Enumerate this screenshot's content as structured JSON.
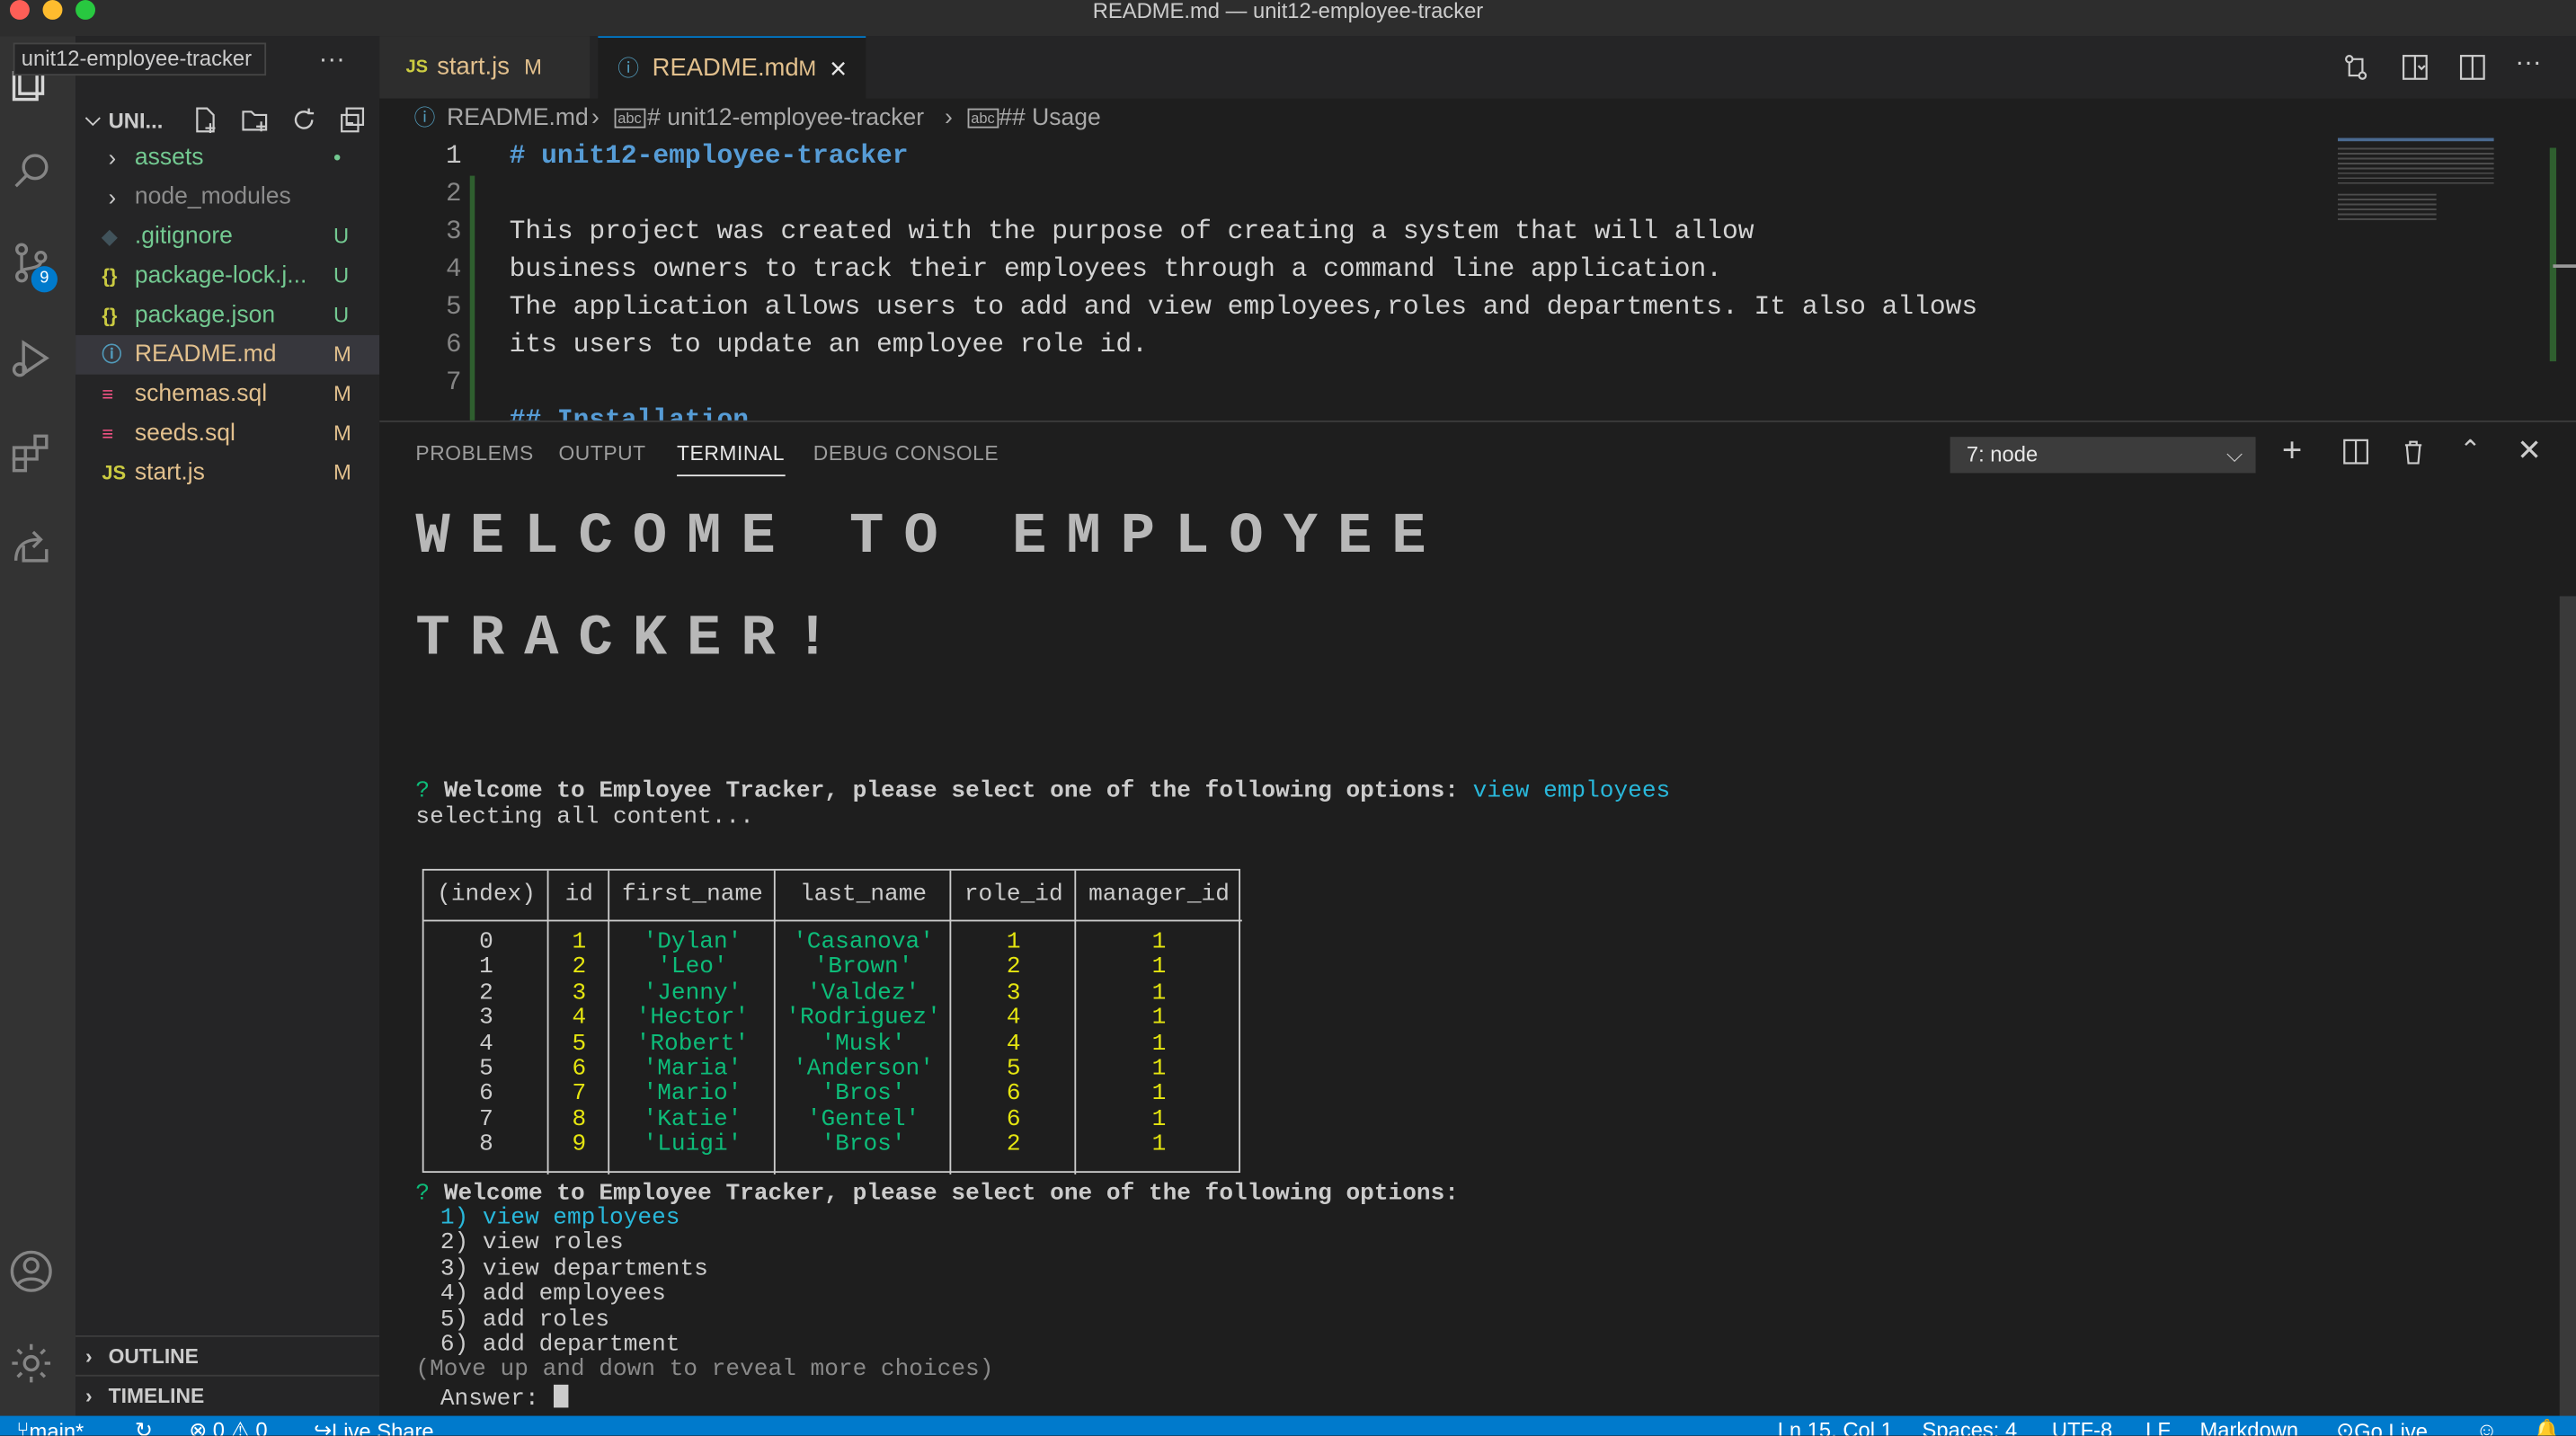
{
  "window": {
    "title": "README.md — unit12-employee-tracker"
  },
  "tooltip": "unit12-employee-tracker",
  "explorer": {
    "root_label": "UNI...",
    "files": [
      {
        "icon": "›",
        "name": "assets",
        "badge": "•",
        "color": "#73c991",
        "badge_color": "#73c991"
      },
      {
        "icon": "›",
        "name": "node_modules",
        "badge": "",
        "color": "#8c8c8c",
        "badge_color": "#8c8c8c"
      },
      {
        "icon": "◆",
        "name": ".gitignore",
        "badge": "U",
        "color": "#73c991",
        "badge_color": "#73c991"
      },
      {
        "icon": "{}",
        "name": "package-lock.j...",
        "badge": "U",
        "color": "#73c991",
        "badge_color": "#73c991"
      },
      {
        "icon": "{}",
        "name": "package.json",
        "badge": "U",
        "color": "#73c991",
        "badge_color": "#73c991"
      },
      {
        "icon": "ⓘ",
        "name": "README.md",
        "badge": "M",
        "color": "#e2c08d",
        "badge_color": "#e2c08d"
      },
      {
        "icon": "≡",
        "name": "schemas.sql",
        "badge": "M",
        "color": "#e2c08d",
        "badge_color": "#e2c08d"
      },
      {
        "icon": "≡",
        "name": "seeds.sql",
        "badge": "M",
        "color": "#e2c08d",
        "badge_color": "#e2c08d"
      },
      {
        "icon": "JS",
        "name": "start.js",
        "badge": "M",
        "color": "#e2c08d",
        "badge_color": "#e2c08d"
      }
    ],
    "outline": "OUTLINE",
    "timeline": "TIMELINE"
  },
  "tabs": [
    {
      "icon": "JS",
      "name": "start.js",
      "badge": "M"
    },
    {
      "icon": "ⓘ",
      "name": "README.md",
      "badge": "M",
      "close": "×"
    }
  ],
  "breadcrumb": {
    "file": "README.md",
    "h1": "# unit12-employee-tracker",
    "h2": "## Usage"
  },
  "editor": {
    "line_numbers": [
      "1",
      "2",
      "3",
      "4",
      "5",
      "6",
      "7"
    ],
    "lines": [
      "# unit12-employee-tracker",
      "",
      "This project was created with the purpose of creating a system that will allow",
      "business owners to track their employees through a command line application.",
      "The application allows users to add and view employees,roles and departments. It also allows",
      "its users to update an employee role id.",
      "",
      "## Installation"
    ]
  },
  "panel": {
    "tabs": [
      "PROBLEMS",
      "OUTPUT",
      "TERMINAL",
      "DEBUG CONSOLE"
    ],
    "terminal_select": "7: node"
  },
  "terminal": {
    "banner_line1": "WELCOME TO EMPLOYEE",
    "banner_line2": "TRACKER!",
    "prompt_mark": "?",
    "prompt1": "Welcome to Employee Tracker, please select one of the following options:",
    "prompt1_answer": "view employees",
    "selecting": "selecting all content...",
    "table": {
      "headers": [
        "(index)",
        "id",
        "first_name",
        "last_name",
        "role_id",
        "manager_id"
      ],
      "rows": [
        [
          "0",
          "1",
          "'Dylan'",
          "'Casanova'",
          "1",
          "1"
        ],
        [
          "1",
          "2",
          "'Leo'",
          "'Brown'",
          "2",
          "1"
        ],
        [
          "2",
          "3",
          "'Jenny'",
          "'Valdez'",
          "3",
          "1"
        ],
        [
          "3",
          "4",
          "'Hector'",
          "'Rodriguez'",
          "4",
          "1"
        ],
        [
          "4",
          "5",
          "'Robert'",
          "'Musk'",
          "4",
          "1"
        ],
        [
          "5",
          "6",
          "'Maria'",
          "'Anderson'",
          "5",
          "1"
        ],
        [
          "6",
          "7",
          "'Mario'",
          "'Bros'",
          "6",
          "1"
        ],
        [
          "7",
          "8",
          "'Katie'",
          "'Gentel'",
          "6",
          "1"
        ],
        [
          "8",
          "9",
          "'Luigi'",
          "'Bros'",
          "2",
          "1"
        ]
      ]
    },
    "prompt2": "Welcome to Employee Tracker, please select one of the following options:",
    "options": [
      "1) view employees",
      "2) view roles",
      "3) view departments",
      "4) add employees",
      "5) add roles",
      "6) add department"
    ],
    "hint": "(Move up and down to reveal more choices)",
    "answer_label": "Answer:"
  },
  "statusbar": {
    "branch": "main*",
    "errors": "⊗ 0 ⚠ 0",
    "liveshare": "Live Share",
    "position": "Ln 15, Col 1",
    "spaces": "Spaces: 4",
    "encoding": "UTF-8",
    "eol": "LF",
    "language": "Markdown",
    "golive": "Go Live"
  },
  "colors": {
    "accent": "#007acc",
    "modified": "#e2c08d",
    "untracked": "#73c991",
    "string_green": "#0dbc79",
    "number_yellow": "#e5e510",
    "cyan": "#29b8db"
  }
}
